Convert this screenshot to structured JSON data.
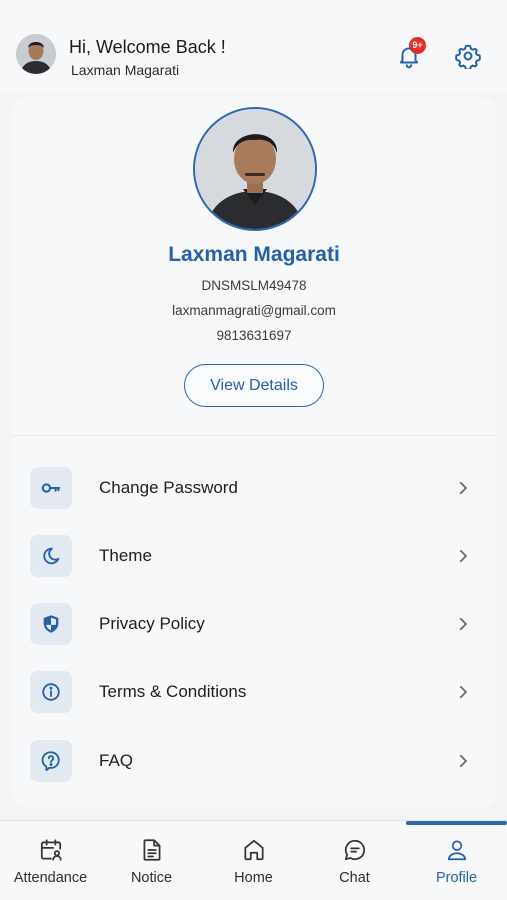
{
  "header": {
    "greeting": "Hi, Welcome Back !",
    "user_name": "Laxman Magarati",
    "notification_badge": "9+",
    "avatar_icon": "user-photo",
    "bell_icon": "bell-icon",
    "settings_icon": "gear-icon"
  },
  "profile": {
    "name": "Laxman Magarati",
    "employee_id": "DNSMSLM49478",
    "email": "laxmanmagrati@gmail.com",
    "phone": "9813631697",
    "view_details_label": "View Details"
  },
  "menu": [
    {
      "label": "Change Password",
      "icon": "key-icon"
    },
    {
      "label": "Theme",
      "icon": "moon-icon"
    },
    {
      "label": "Privacy Policy",
      "icon": "shield-icon"
    },
    {
      "label": "Terms & Conditions",
      "icon": "info-icon"
    },
    {
      "label": "FAQ",
      "icon": "question-icon"
    }
  ],
  "bottom_nav": [
    {
      "label": "Attendance",
      "icon": "calendar-user-icon",
      "active": false
    },
    {
      "label": "Notice",
      "icon": "document-icon",
      "active": false
    },
    {
      "label": "Home",
      "icon": "home-icon",
      "active": false
    },
    {
      "label": "Chat",
      "icon": "chat-icon",
      "active": false
    },
    {
      "label": "Profile",
      "icon": "user-icon",
      "active": true
    }
  ],
  "colors": {
    "accent": "#2561a8",
    "badge": "#e0302b",
    "background": "#f2f4f6",
    "card": "#f7f8f9"
  }
}
